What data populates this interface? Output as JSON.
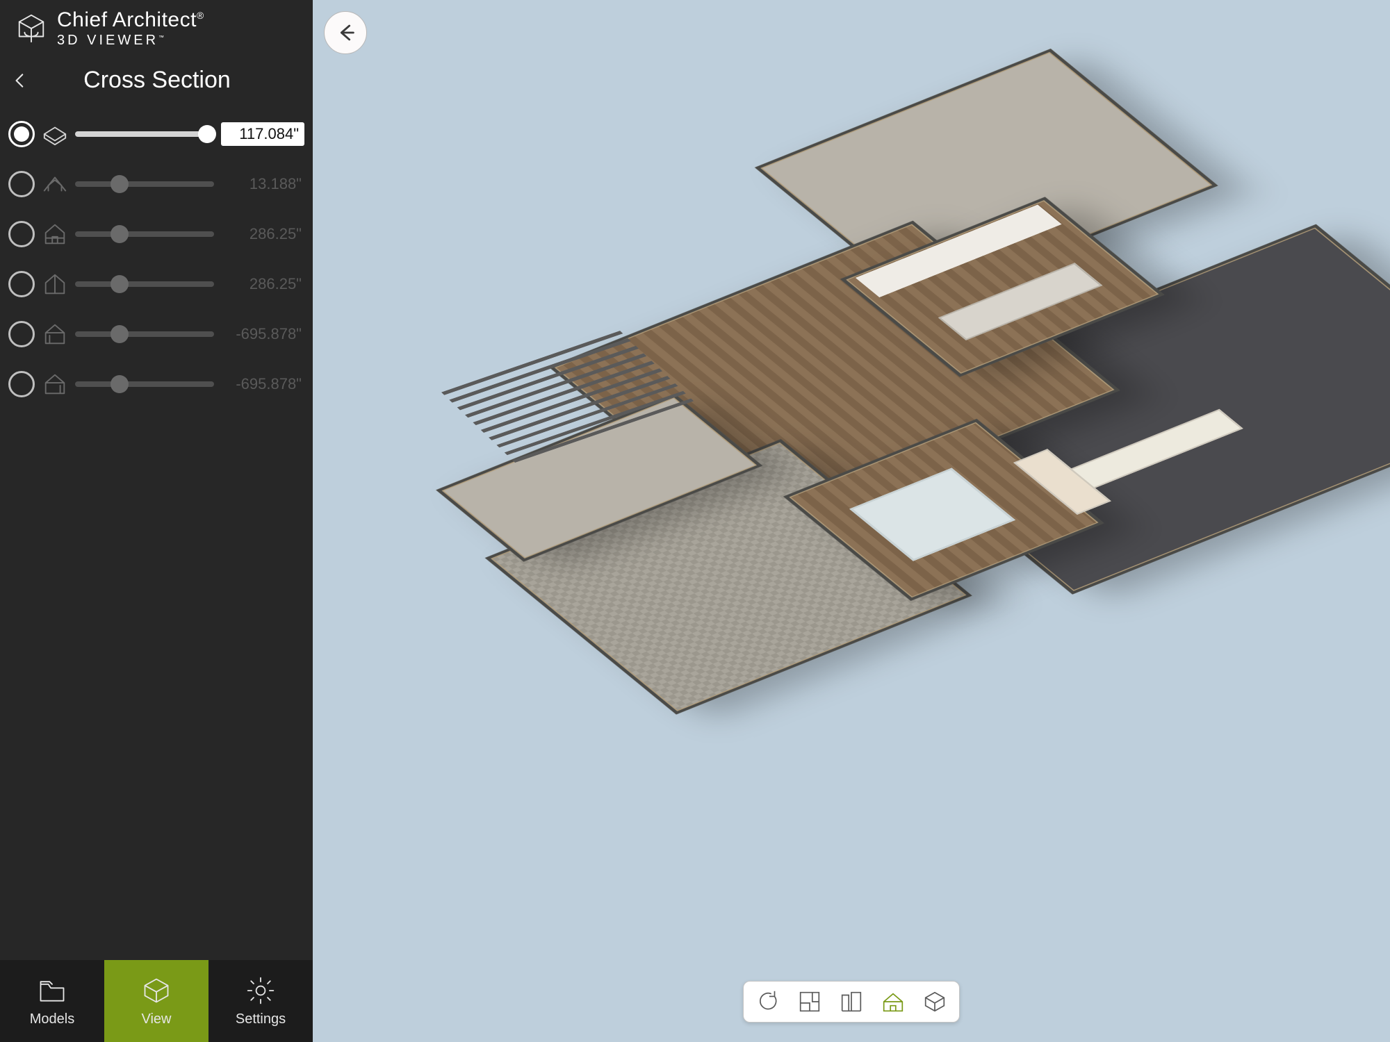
{
  "app": {
    "brand_line1": "Chief Architect",
    "brand_line2": "3D VIEWER"
  },
  "panel": {
    "title": "Cross Section",
    "rows": [
      {
        "icon": "cap-horizontal",
        "value": "117.084\"",
        "percent": 95,
        "active": true
      },
      {
        "icon": "roof-slope",
        "value": "13.188\"",
        "percent": 32,
        "active": false
      },
      {
        "icon": "house-cut-front",
        "value": "286.25\"",
        "percent": 32,
        "active": false
      },
      {
        "icon": "house-cut-back",
        "value": "286.25\"",
        "percent": 32,
        "active": false
      },
      {
        "icon": "house-cut-left",
        "value": "-695.878\"",
        "percent": 32,
        "active": false
      },
      {
        "icon": "house-cut-right",
        "value": "-695.878\"",
        "percent": 32,
        "active": false
      }
    ]
  },
  "bottom_nav": {
    "models": "Models",
    "view": "View",
    "settings": "Settings",
    "active": "view"
  },
  "viewport_toolbar": {
    "items": [
      "reset-view",
      "floor-plan",
      "elevation",
      "dollhouse",
      "perspective"
    ],
    "active": "dollhouse"
  },
  "colors": {
    "sidebar_bg": "#272727",
    "accent": "#7a9a17",
    "sky": "#becfdc"
  }
}
